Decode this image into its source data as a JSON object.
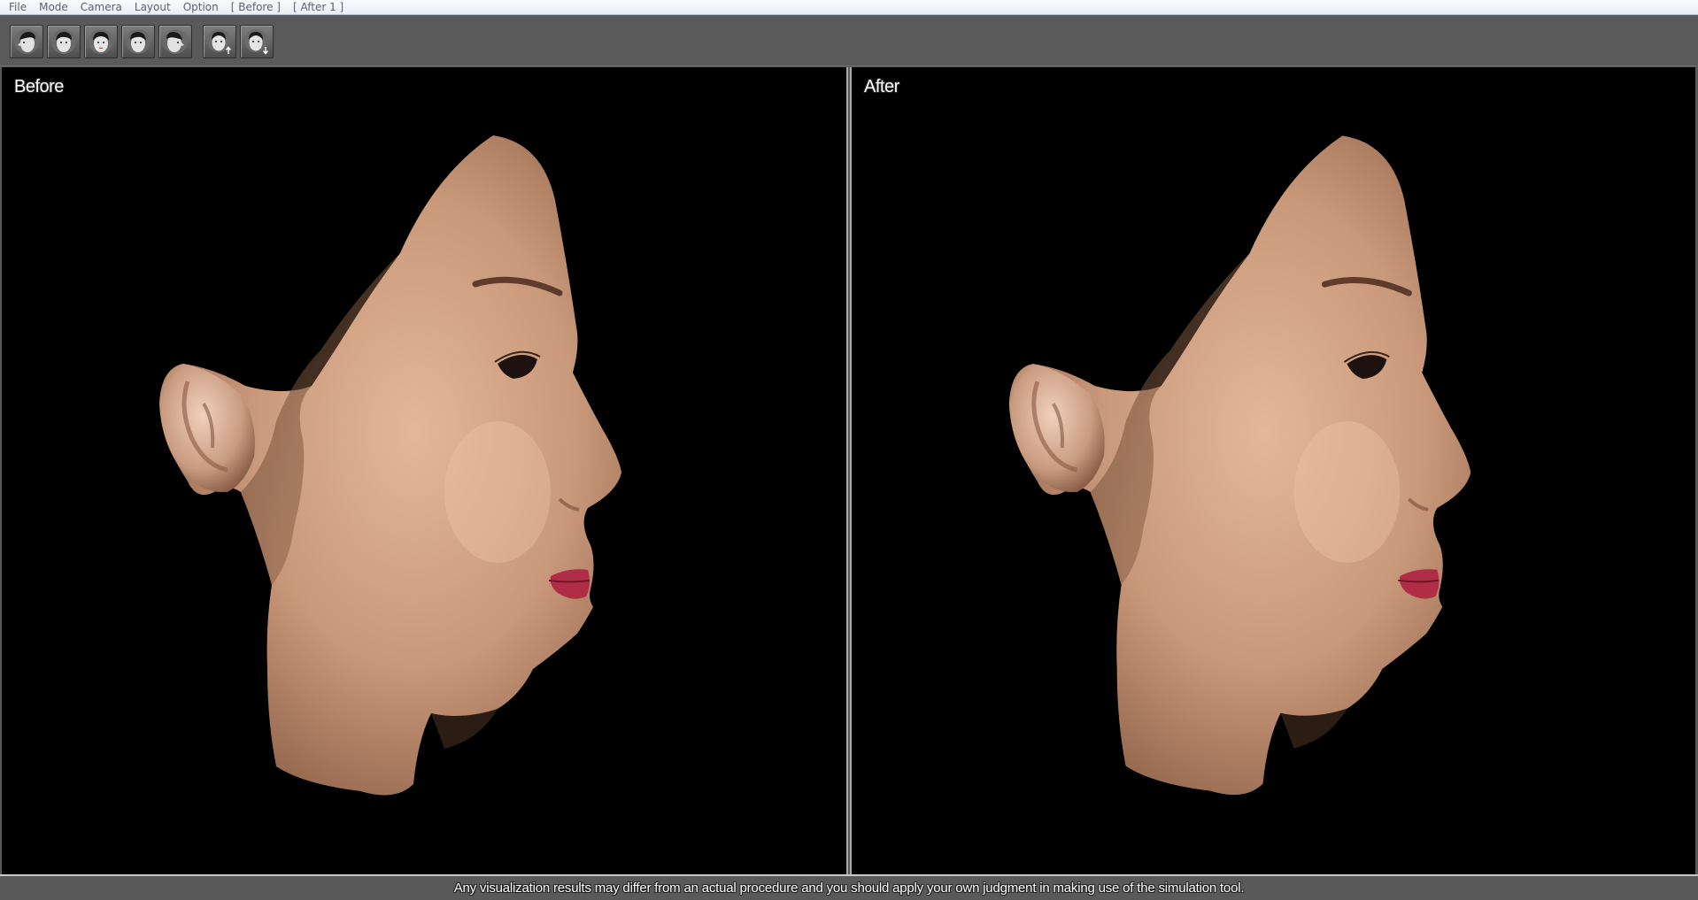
{
  "menu": {
    "items": [
      "File",
      "Mode",
      "Camera",
      "Layout",
      "Option",
      "[ Before ]",
      "[ After 1 ]"
    ]
  },
  "toolbar": {
    "buttons": [
      {
        "icon": "face-left-profile-icon"
      },
      {
        "icon": "face-left-quarter-icon"
      },
      {
        "icon": "face-front-icon"
      },
      {
        "icon": "face-right-quarter-icon"
      },
      {
        "icon": "face-right-profile-icon"
      },
      {
        "icon": "face-tilt-up-icon"
      },
      {
        "icon": "face-tilt-down-icon"
      }
    ]
  },
  "viewports": {
    "before": {
      "label": "Before"
    },
    "after": {
      "label": "After"
    }
  },
  "status": {
    "disclaimer": "Any visualization results may differ from an actual procedure and you should apply your own judgment in making use of the simulation tool."
  },
  "colors": {
    "background": "#595959",
    "viewport": "#000000",
    "skin": "#c79a78",
    "lips": "#b02e45"
  }
}
